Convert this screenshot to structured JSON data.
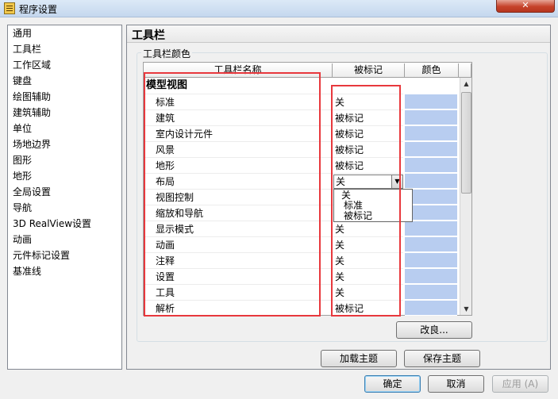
{
  "window": {
    "title": "程序设置",
    "close_glyph": "✕"
  },
  "nav": {
    "items": [
      {
        "id": "general",
        "label": "通用"
      },
      {
        "id": "toolbar",
        "label": "工具栏"
      },
      {
        "id": "workspace",
        "label": "工作区域"
      },
      {
        "id": "keyboard",
        "label": "键盘"
      },
      {
        "id": "drawing-aid",
        "label": "绘图辅助"
      },
      {
        "id": "architecture-aid",
        "label": "建筑辅助"
      },
      {
        "id": "units",
        "label": "单位"
      },
      {
        "id": "site-boundary",
        "label": "场地边界"
      },
      {
        "id": "graphics",
        "label": "图形"
      },
      {
        "id": "terrain",
        "label": "地形"
      },
      {
        "id": "global-settings",
        "label": "全局设置"
      },
      {
        "id": "navigation",
        "label": "导航"
      },
      {
        "id": "realview",
        "label": "3D RealView设置"
      },
      {
        "id": "animation",
        "label": "动画"
      },
      {
        "id": "component-tag",
        "label": "元件标记设置"
      },
      {
        "id": "baseline",
        "label": "基准线"
      }
    ]
  },
  "panel": {
    "title": "工具栏"
  },
  "group": {
    "label": "工具栏颜色"
  },
  "table": {
    "columns": [
      "工具栏名称",
      "被标记",
      "颜色"
    ],
    "category": "模型视图",
    "rows": [
      {
        "name": "标准",
        "marked": "关"
      },
      {
        "name": "建筑",
        "marked": "被标记"
      },
      {
        "name": "室内设计元件",
        "marked": "被标记"
      },
      {
        "name": "风景",
        "marked": "被标记"
      },
      {
        "name": "地形",
        "marked": "被标记"
      },
      {
        "name": "布局",
        "marked": ""
      },
      {
        "name": "视图控制",
        "marked": "标"
      },
      {
        "name": "缩放和导航",
        "marked": "标"
      },
      {
        "name": "显示模式",
        "marked": "关"
      },
      {
        "name": "动画",
        "marked": "关"
      },
      {
        "name": "注释",
        "marked": "关"
      },
      {
        "name": "设置",
        "marked": "关"
      },
      {
        "name": "工具",
        "marked": "关"
      },
      {
        "name": "解析",
        "marked": "被标记"
      }
    ],
    "color_hex": "#b8cdf0"
  },
  "dropdown": {
    "value": "关",
    "options": [
      "关",
      "标准",
      "被标记"
    ]
  },
  "buttons": {
    "improve": "改良...",
    "load_theme": "加载主题",
    "save_theme": "保存主题",
    "ok": "确定",
    "cancel": "取消",
    "apply": "应用 (A)"
  },
  "highlight_color": "#e8383d"
}
